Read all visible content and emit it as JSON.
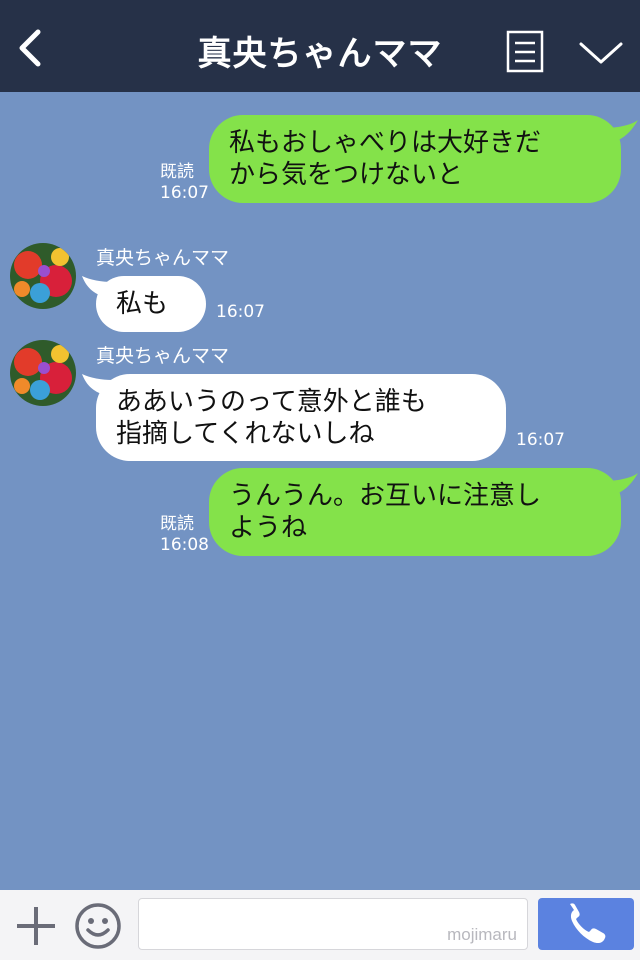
{
  "header": {
    "title": "真央ちゃんママ"
  },
  "messages": [
    {
      "direction": "outgoing",
      "text": "私もおしゃべりは大好きだ\nから気をつけないと",
      "read": "既読",
      "time": "16:07"
    },
    {
      "direction": "incoming",
      "sender": "真央ちゃんママ",
      "text": "私も",
      "time": "16:07"
    },
    {
      "direction": "incoming",
      "sender": "真央ちゃんママ",
      "text": "ああいうのって意外と誰も\n指摘してくれないしね",
      "time": "16:07"
    },
    {
      "direction": "outgoing",
      "text": "うんうん。お互いに注意し\nようね",
      "read": "既読",
      "time": "16:08"
    }
  ],
  "footer": {
    "watermark": "mojimaru"
  },
  "colors": {
    "header_bg": "#263148",
    "chat_bg": "#7393c3",
    "outgoing_bubble": "#84e24a",
    "incoming_bubble": "#ffffff",
    "call_button": "#5b82e0"
  },
  "icons": [
    "back-arrow-icon",
    "menu-icon",
    "chevron-down-icon",
    "plus-icon",
    "smiley-icon",
    "phone-icon"
  ]
}
